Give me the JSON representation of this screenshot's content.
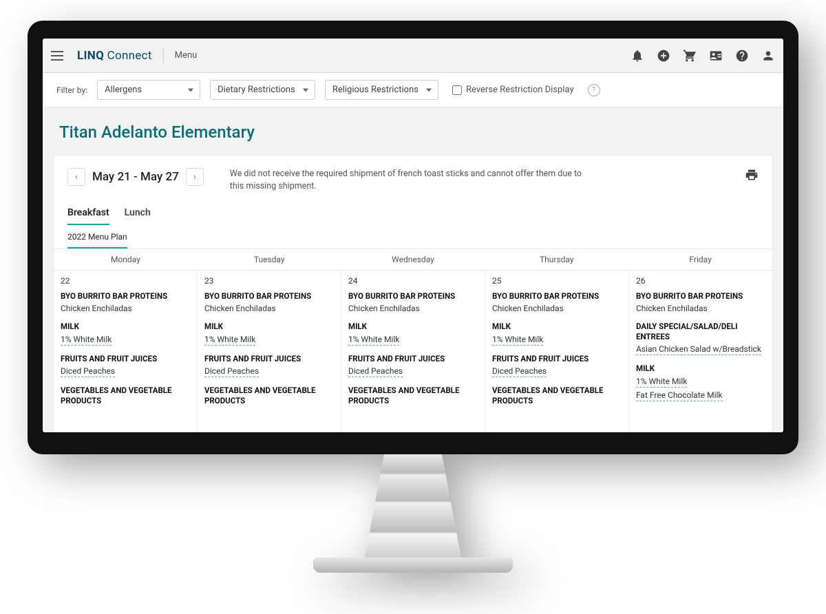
{
  "header": {
    "brand_bold": "LINQ",
    "brand_light": "Connect",
    "page_label": "Menu"
  },
  "filters": {
    "label": "Filter by:",
    "dropdowns": [
      "Allergens",
      "Dietary Restrictions",
      "Religious Restrictions"
    ],
    "reverse_label": "Reverse Restriction Display"
  },
  "school": "Titan Adelanto Elementary",
  "date_range": "May 21 - May 27",
  "notice": "We did not receive the required shipment of french toast sticks and cannot offer them due to this missing shipment.",
  "meal_tabs": {
    "items": [
      "Breakfast",
      "Lunch"
    ],
    "active": 0
  },
  "plan_tabs": {
    "items": [
      "2022 Menu Plan"
    ],
    "active": 0
  },
  "weekday_headers": [
    "Monday",
    "Tuesday",
    "Wednesday",
    "Thursday",
    "Friday"
  ],
  "days": [
    {
      "date": "22",
      "sections": [
        {
          "cat": "BYO BURRITO BAR PROTEINS",
          "items": [
            {
              "t": "Chicken Enchiladas"
            }
          ]
        },
        {
          "cat": "MILK",
          "items": [
            {
              "t": "1% White Milk",
              "linked": true
            }
          ]
        },
        {
          "cat": "FRUITS AND FRUIT JUICES",
          "items": [
            {
              "t": "Diced Peaches",
              "linked": true
            }
          ]
        },
        {
          "cat": "VEGETABLES AND VEGETABLE PRODUCTS",
          "items": []
        }
      ]
    },
    {
      "date": "23",
      "sections": [
        {
          "cat": "BYO BURRITO BAR PROTEINS",
          "items": [
            {
              "t": "Chicken Enchiladas"
            }
          ]
        },
        {
          "cat": "MILK",
          "items": [
            {
              "t": "1% White Milk",
              "linked": true
            }
          ]
        },
        {
          "cat": "FRUITS AND FRUIT JUICES",
          "items": [
            {
              "t": "Diced Peaches",
              "linked": true
            }
          ]
        },
        {
          "cat": "VEGETABLES AND VEGETABLE PRODUCTS",
          "items": []
        }
      ]
    },
    {
      "date": "24",
      "sections": [
        {
          "cat": "BYO BURRITO BAR PROTEINS",
          "items": [
            {
              "t": "Chicken Enchiladas"
            }
          ]
        },
        {
          "cat": "MILK",
          "items": [
            {
              "t": "1% White Milk",
              "linked": true
            }
          ]
        },
        {
          "cat": "FRUITS AND FRUIT JUICES",
          "items": [
            {
              "t": "Diced Peaches",
              "linked": true
            }
          ]
        },
        {
          "cat": "VEGETABLES AND VEGETABLE PRODUCTS",
          "items": []
        }
      ]
    },
    {
      "date": "25",
      "sections": [
        {
          "cat": "BYO BURRITO BAR PROTEINS",
          "items": [
            {
              "t": "Chicken Enchiladas"
            }
          ]
        },
        {
          "cat": "MILK",
          "items": [
            {
              "t": "1% White Milk",
              "linked": true
            }
          ]
        },
        {
          "cat": "FRUITS AND FRUIT JUICES",
          "items": [
            {
              "t": "Diced Peaches",
              "linked": true
            }
          ]
        },
        {
          "cat": "VEGETABLES AND VEGETABLE PRODUCTS",
          "items": []
        }
      ]
    },
    {
      "date": "26",
      "sections": [
        {
          "cat": "BYO BURRITO BAR PROTEINS",
          "items": [
            {
              "t": "Chicken Enchiladas"
            }
          ]
        },
        {
          "cat": "DAILY SPECIAL/SALAD/DELI ENTREES",
          "items": [
            {
              "t": "Asian Chicken Salad w/Breadstick",
              "linked": true
            }
          ]
        },
        {
          "cat": "MILK",
          "items": [
            {
              "t": "1% White Milk",
              "linked": true
            },
            {
              "t": "Fat Free Chocolate Milk",
              "linked": true
            }
          ]
        }
      ]
    }
  ]
}
